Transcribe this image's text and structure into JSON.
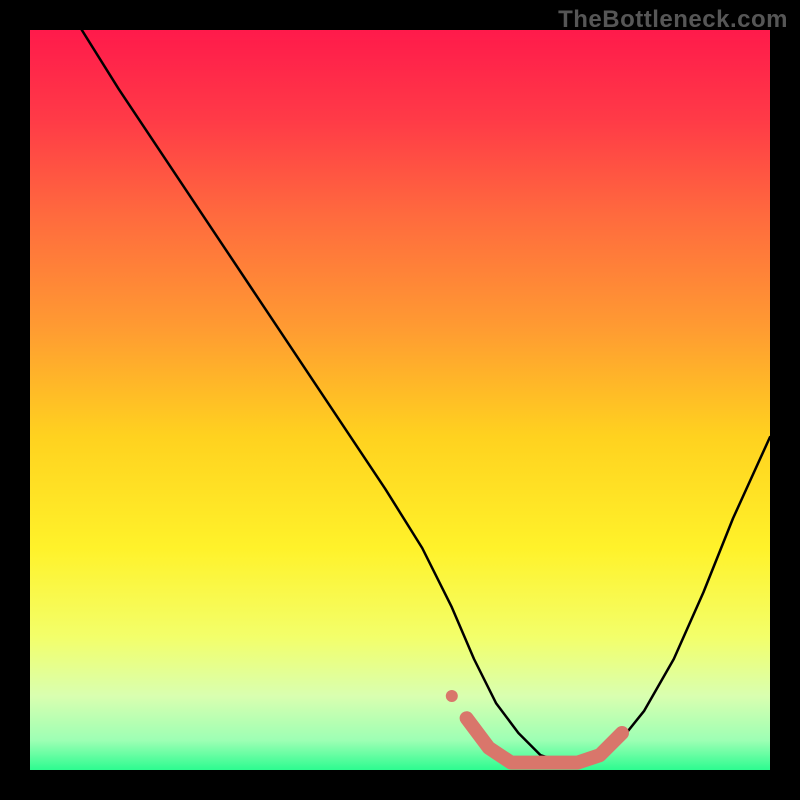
{
  "watermark": "TheBottleneck.com",
  "gradient": {
    "stops": [
      {
        "offset": 0.0,
        "color": "#ff1a4b"
      },
      {
        "offset": 0.12,
        "color": "#ff3a47"
      },
      {
        "offset": 0.25,
        "color": "#ff6a3e"
      },
      {
        "offset": 0.4,
        "color": "#ff9a32"
      },
      {
        "offset": 0.55,
        "color": "#ffd21f"
      },
      {
        "offset": 0.7,
        "color": "#fff22a"
      },
      {
        "offset": 0.82,
        "color": "#f3ff6a"
      },
      {
        "offset": 0.9,
        "color": "#d9ffb0"
      },
      {
        "offset": 0.96,
        "color": "#9dffb4"
      },
      {
        "offset": 1.0,
        "color": "#2dfc90"
      }
    ]
  },
  "chart_data": {
    "type": "line",
    "title": "",
    "xlabel": "",
    "ylabel": "",
    "xlim": [
      0,
      100
    ],
    "ylim": [
      0,
      100
    ],
    "series": [
      {
        "name": "bottleneck-curve",
        "x": [
          7,
          12,
          18,
          24,
          30,
          36,
          42,
          48,
          53,
          57,
          60,
          63,
          66,
          69,
          72,
          75,
          79,
          83,
          87,
          91,
          95,
          100
        ],
        "y": [
          100,
          92,
          83,
          74,
          65,
          56,
          47,
          38,
          30,
          22,
          15,
          9,
          5,
          2,
          1,
          1,
          3,
          8,
          15,
          24,
          34,
          45
        ]
      }
    ],
    "highlight": {
      "name": "optimal-band",
      "color": "#d9766b",
      "x": [
        59,
        62,
        65,
        68,
        71,
        74,
        77,
        80
      ],
      "y": [
        7,
        3,
        1,
        1,
        1,
        1,
        2,
        5
      ],
      "endpoint_radius": 6,
      "band_thickness": 14
    }
  }
}
